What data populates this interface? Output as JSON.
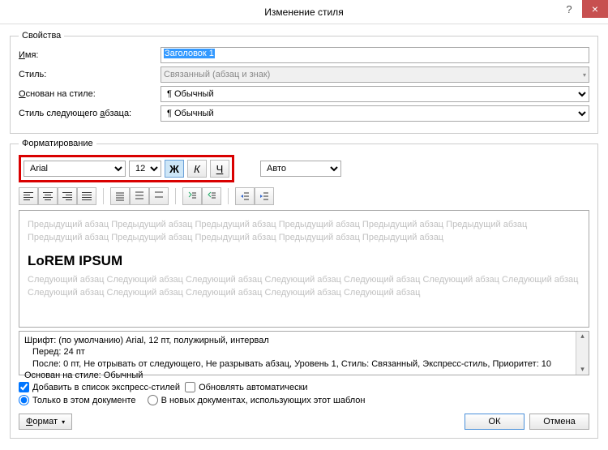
{
  "title": "Изменение стиля",
  "properties_legend": "Свойства",
  "labels": {
    "name": "Имя:",
    "style": "Стиль:",
    "based_on": "Основан на стиле:",
    "next_style": "Стиль следующего абзаца:"
  },
  "name_value": "Заголовок 1",
  "style_value": "Связанный (абзац и знак)",
  "based_on_value": "Обычный",
  "next_style_value": "Обычный",
  "formatting_legend": "Форматирование",
  "font": "Arial",
  "size": "12",
  "auto": "Авто",
  "bold": "Ж",
  "italic": "К",
  "underline": "Ч",
  "preview": {
    "prev": "Предыдущий абзац Предыдущий абзац Предыдущий абзац Предыдущий абзац Предыдущий абзац Предыдущий абзац Предыдущий абзац Предыдущий абзац Предыдущий абзац Предыдущий абзац Предыдущий абзац",
    "sample": "LoREM IPSUM",
    "next": "Следующий абзац Следующий абзац Следующий абзац Следующий абзац Следующий абзац Следующий абзац Следующий абзац Следующий абзац Следующий абзац Следующий абзац Следующий абзац Следующий абзац"
  },
  "description": {
    "line1": "Шрифт: (по умолчанию) Arial, 12 пт, полужирный, интервал",
    "line2": "Перед:  24 пт",
    "line3": "После:  0 пт, Не отрывать от следующего, Не разрывать абзац, Уровень 1, Стиль: Связанный, Экспресс-стиль, Приоритет: 10",
    "line4": "Основан на стиле: Обычный"
  },
  "checkboxes": {
    "add_quick": "Добавить в список экспресс-стилей",
    "auto_update": "Обновлять автоматически"
  },
  "radios": {
    "this_doc": "Только в этом документе",
    "new_docs": "В новых документах, использующих этот шаблон"
  },
  "buttons": {
    "format": "Формат",
    "ok": "ОК",
    "cancel": "Отмена"
  },
  "pilcrow": "¶"
}
